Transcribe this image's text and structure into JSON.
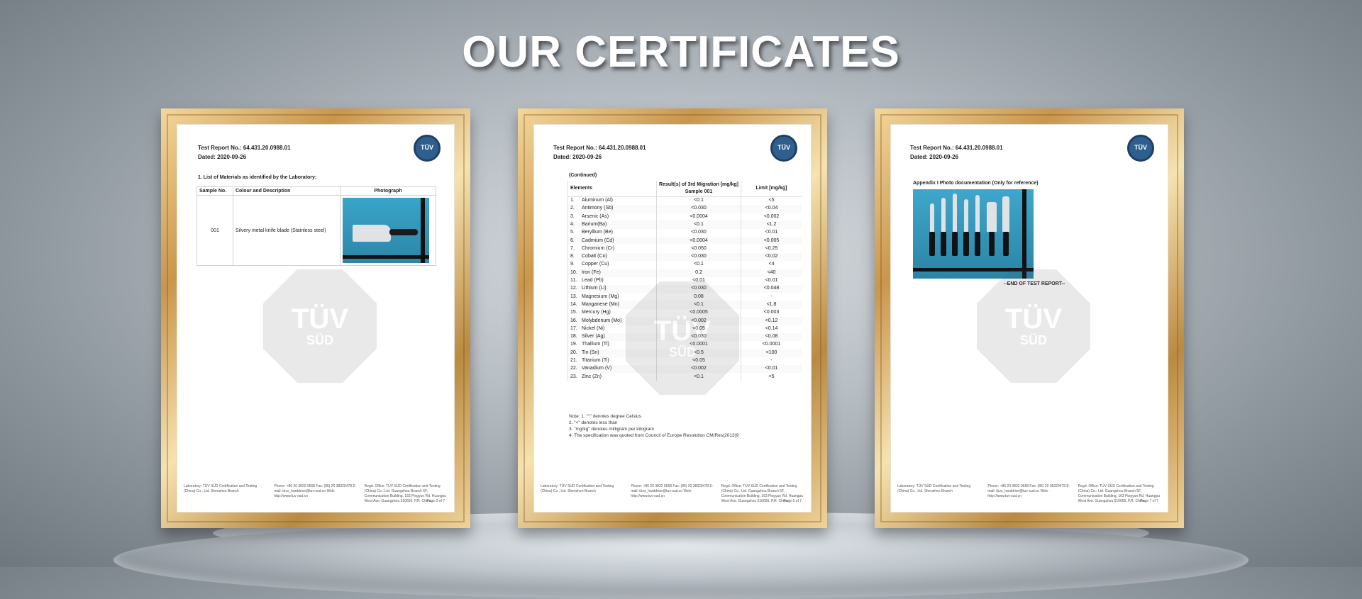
{
  "page_title": "OUR CERTIFICATES",
  "cert1": {
    "report_no": "Test Report No.: 64.431.20.0988.01",
    "dated": "Dated: 2020-09-26",
    "logo": "TÜV",
    "section": "1.     List of Materials as identified by the Laboratory:",
    "headers": [
      "Sample No.",
      "Colour and Description",
      "Photograph"
    ],
    "sample_no": "001",
    "description": "Silvery metal knife blade (Stainless steel)",
    "page": "Page 3 of 7"
  },
  "cert2": {
    "report_no": "Test Report No.: 64.431.20.0988.01",
    "dated": "Dated: 2020-09-26",
    "logo": "TÜV",
    "continued": "(Continued)",
    "col_elements": "Elements",
    "col_result": "Result(s) of 3rd Migration [mg/kg] Sample 001",
    "col_limit": "Limit [mg/kg]",
    "rows": [
      {
        "n": "1.",
        "el": "Aluminum (Al)",
        "r": "<0.1",
        "l": "<5"
      },
      {
        "n": "2.",
        "el": "Antimony (Sb)",
        "r": "<0.030",
        "l": "<0.04"
      },
      {
        "n": "3.",
        "el": "Arsenic (As)",
        "r": "<0.0004",
        "l": "<0.002"
      },
      {
        "n": "4.",
        "el": "Barium(Ba)",
        "r": "<0.1",
        "l": "<1.2"
      },
      {
        "n": "5.",
        "el": "Beryllium (Be)",
        "r": "<0.030",
        "l": "<0.01"
      },
      {
        "n": "6.",
        "el": "Cadmium (Cd)",
        "r": "<0.0004",
        "l": "<0.005"
      },
      {
        "n": "7.",
        "el": "Chromium (Cr)",
        "r": "<0.050",
        "l": "<0.25"
      },
      {
        "n": "8.",
        "el": "Cobalt (Co)",
        "r": "<0.030",
        "l": "<0.02"
      },
      {
        "n": "9.",
        "el": "Copper (Cu)",
        "r": "<0.1",
        "l": "<4"
      },
      {
        "n": "10.",
        "el": "Iron (Fe)",
        "r": "0.2",
        "l": "<40"
      },
      {
        "n": "11.",
        "el": "Lead (Pb)",
        "r": "<0.01",
        "l": "<0.01"
      },
      {
        "n": "12.",
        "el": "Lithium (Li)",
        "r": "<0.030",
        "l": "<0.048"
      },
      {
        "n": "13.",
        "el": "Magnesium (Mg)",
        "r": "0.08",
        "l": "-"
      },
      {
        "n": "14.",
        "el": "Manganese (Mn)",
        "r": "<0.1",
        "l": "<1.8"
      },
      {
        "n": "15.",
        "el": "Mercury (Hg)",
        "r": "<0.0005",
        "l": "<0.003"
      },
      {
        "n": "16.",
        "el": "Molybdenum (Mo)",
        "r": "<0.002",
        "l": "<0.12"
      },
      {
        "n": "17.",
        "el": "Nickel (Ni)",
        "r": "<0.05",
        "l": "<0.14"
      },
      {
        "n": "18.",
        "el": "Silver (Ag)",
        "r": "<0.030",
        "l": "<0.08"
      },
      {
        "n": "19.",
        "el": "Thallium (Tl)",
        "r": "<0.0001",
        "l": "<0.0001"
      },
      {
        "n": "20.",
        "el": "Tin (Sn)",
        "r": "<0.5",
        "l": "<100"
      },
      {
        "n": "21.",
        "el": "Titanium (Ti)",
        "r": "<0.05",
        "l": "-"
      },
      {
        "n": "22.",
        "el": "Vanadium (V)",
        "r": "<0.002",
        "l": "<0.01"
      },
      {
        "n": "23.",
        "el": "Zinc (Zn)",
        "r": "<0.1",
        "l": "<5"
      }
    ],
    "notes": [
      "Note:   1. \"°\" denotes degree Celsius",
      "           2. \"<\" denotes less than",
      "           3. \"mg/kg\" denotes milligram per kilogram",
      "           4. The specification was quoted from Council of Europe Resolution CM/Res(2013)9"
    ],
    "page": "Page 5 of 7"
  },
  "cert3": {
    "report_no": "Test Report No.: 64.431.20.0988.01",
    "dated": "Dated: 2020-09-26",
    "logo": "TÜV",
    "appendix": "Appendix I       Photo documentation (Only for reference)",
    "end": "--END OF TEST REPORT--",
    "page": "Page 7 of 7"
  },
  "footer": {
    "lab": "Laboratory: TÜV SÜD Certification and Testing (China) Co., Ltd. Shenzhen Branch",
    "contact": "Phone: +86 20 3832 0668  Fax: (86) 20 38320478  E-mail: tüvs_harddrive@tuv-sud.cn  Web: http://www.tuv-sud.cn",
    "office": "Regd. Office: TÜV SÜD Certification and Testing (China) Co., Ltd. Guangzhou Branch 5F, Communication Building, 163 Pingyun Rd. Huangpu West Ave. Guangzhou 510656, P.R. China"
  },
  "watermark": {
    "top": "TÜV",
    "bottom": "SÜD"
  }
}
